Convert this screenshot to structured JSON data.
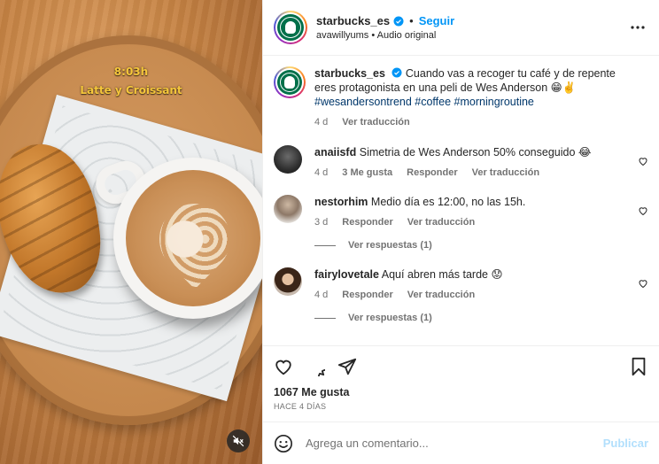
{
  "video": {
    "overlay_time": "8:03h",
    "overlay_caption": "Latte y Croissant",
    "mute_icon": "muted-speaker-icon"
  },
  "header": {
    "username": "starbucks_es",
    "separator": "•",
    "follow_label": "Seguir",
    "audio_line": "avawillyums • Audio original"
  },
  "caption": {
    "username": "starbucks_es",
    "text": "Cuando vas a recoger tu café y de repente eres protagonista en una peli de Wes Anderson 😁✌️",
    "hashtags": [
      "#wesandersontrend",
      "#coffee",
      "#morningroutine"
    ],
    "time": "4 d",
    "translate_label": "Ver traducción"
  },
  "comments": [
    {
      "username": "anaiisfd",
      "text": "Simetria de Wes Anderson 50% conseguido 😂",
      "time": "4 d",
      "likes_label": "3 Me gusta",
      "reply_label": "Responder",
      "translate_label": "Ver traducción",
      "replies_label": ""
    },
    {
      "username": "nestorhim",
      "text": "Medio día es 12:00, no las 15h.",
      "time": "3 d",
      "likes_label": "",
      "reply_label": "Responder",
      "translate_label": "Ver traducción",
      "replies_label": "Ver respuestas (1)"
    },
    {
      "username": "fairylovetale",
      "text": "Aquí abren más tarde 😟",
      "time": "4 d",
      "likes_label": "",
      "reply_label": "Responder",
      "translate_label": "Ver traducción",
      "replies_label": "Ver respuestas (1)"
    }
  ],
  "actions": {
    "like_icon": "heart-icon",
    "comment_icon": "comment-bubble-icon",
    "share_icon": "paper-plane-icon",
    "save_icon": "bookmark-icon",
    "likes_count": "1067 Me gusta",
    "date": "HACE 4 DÍAS"
  },
  "comment_box": {
    "placeholder": "Agrega un comentario...",
    "publish_label": "Publicar"
  },
  "colors": {
    "accent_blue": "#0095f6",
    "disabled_blue": "#b2dffc",
    "hashtag_blue": "#00376b",
    "starbucks_green": "#00704a",
    "overlay_yellow": "#f6c73b"
  }
}
